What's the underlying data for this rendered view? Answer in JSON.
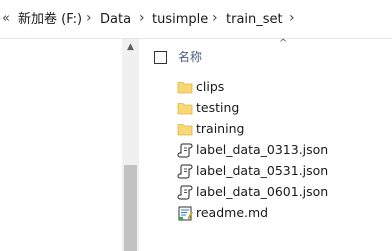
{
  "address_bar": {
    "overflow": "«",
    "crumbs": [
      "新加卷 (F:)",
      "Data",
      "tusimple",
      "train_set"
    ],
    "separator": "›"
  },
  "file_list": {
    "column_name": "名称",
    "sort_indicator": "^",
    "items": [
      {
        "name": "clips",
        "icon": "folder-icon"
      },
      {
        "name": "testing",
        "icon": "folder-icon"
      },
      {
        "name": "training",
        "icon": "folder-icon"
      },
      {
        "name": "label_data_0313.json",
        "icon": "json-file-icon"
      },
      {
        "name": "label_data_0531.json",
        "icon": "json-file-icon"
      },
      {
        "name": "label_data_0601.json",
        "icon": "json-file-icon"
      },
      {
        "name": "readme.md",
        "icon": "markdown-file-icon"
      }
    ]
  },
  "colors": {
    "folder": "#f8d775",
    "folder_dark": "#e0b44c",
    "header_text": "#4c607a"
  }
}
